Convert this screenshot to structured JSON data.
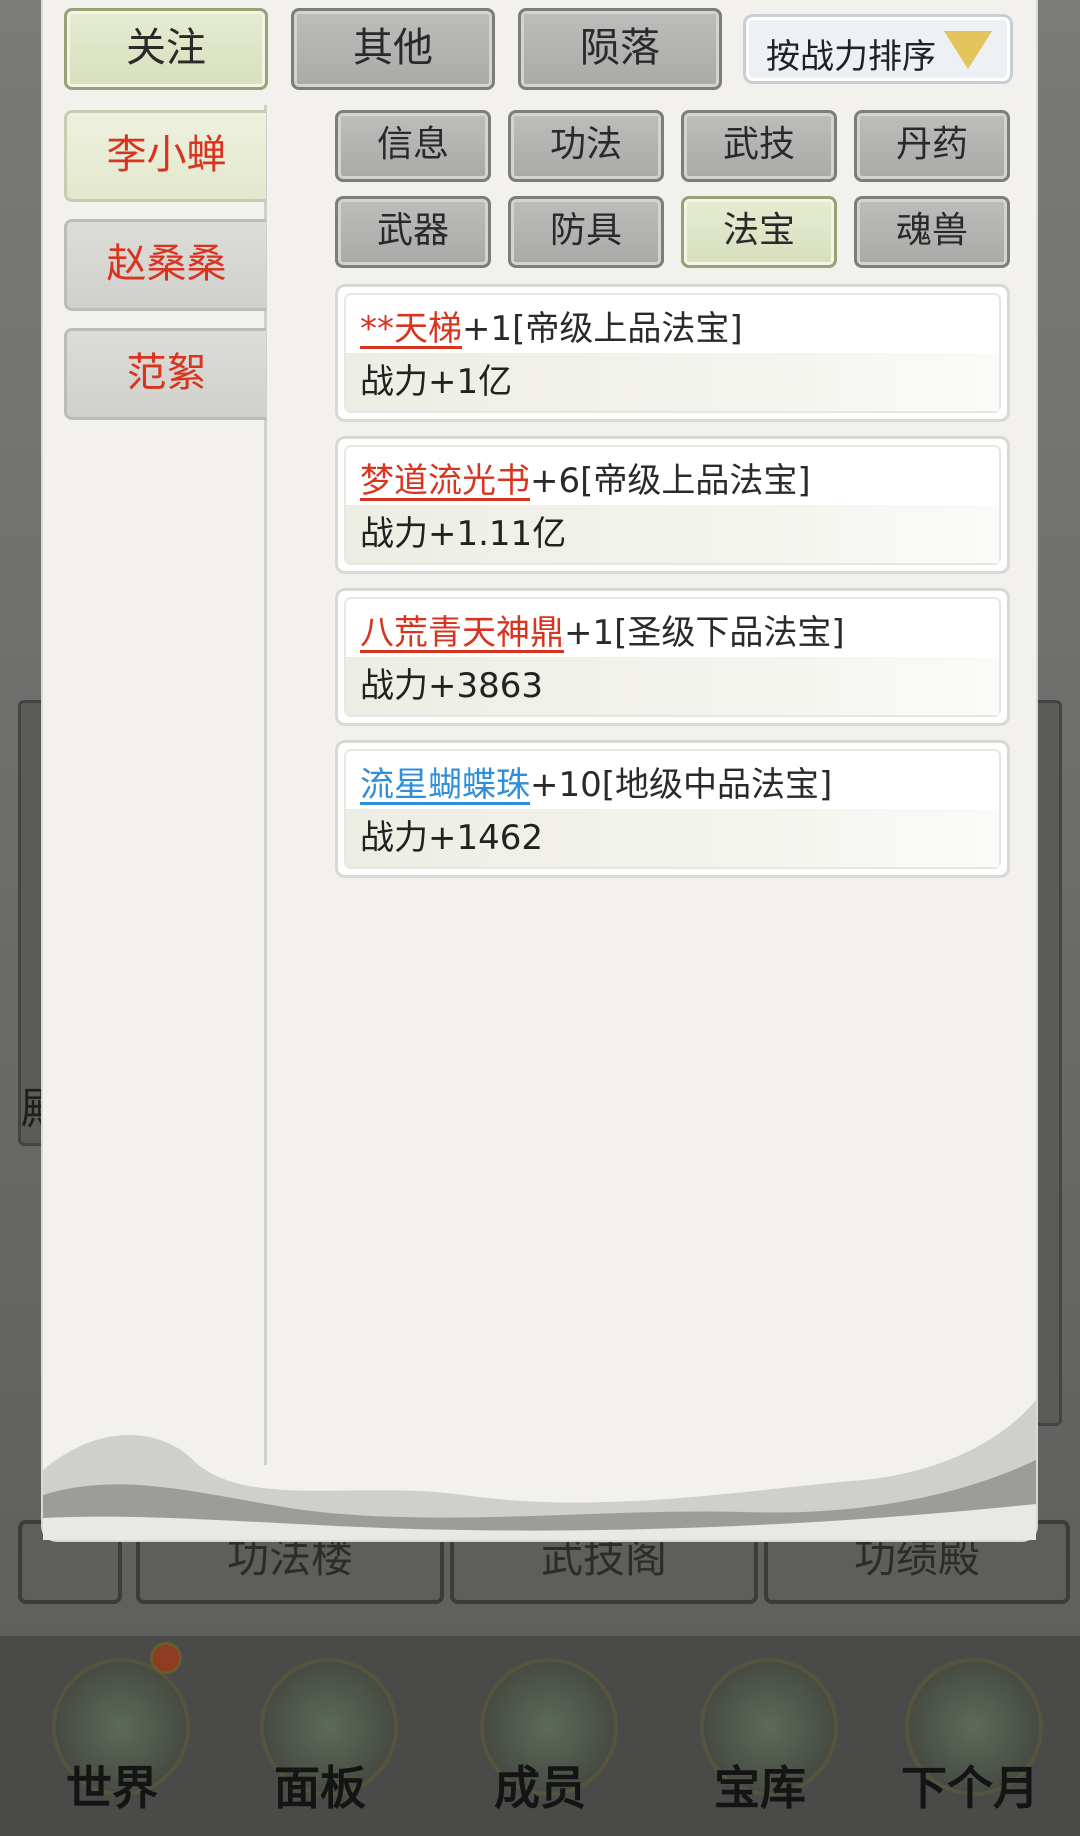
{
  "top_tabs": [
    {
      "label": "关注",
      "active": true
    },
    {
      "label": "其他",
      "active": false
    },
    {
      "label": "陨落",
      "active": false
    }
  ],
  "sort": {
    "label": "按战力排序"
  },
  "members": [
    {
      "name": "李小蝉",
      "active": true
    },
    {
      "name": "赵桑桑",
      "active": false
    },
    {
      "name": "范絮",
      "active": false
    }
  ],
  "categories": [
    {
      "label": "信息",
      "active": false
    },
    {
      "label": "功法",
      "active": false
    },
    {
      "label": "武技",
      "active": false
    },
    {
      "label": "丹药",
      "active": false
    },
    {
      "label": "武器",
      "active": false
    },
    {
      "label": "防具",
      "active": false
    },
    {
      "label": "法宝",
      "active": true
    },
    {
      "label": "魂兽",
      "active": false
    }
  ],
  "items": [
    {
      "name": "**天梯",
      "name_color": "#d8341f",
      "suffix": "+1[帝级上品法宝]",
      "power": "战力+1亿"
    },
    {
      "name": "梦道流光书",
      "name_color": "#d8341f",
      "suffix": "+6[帝级上品法宝]",
      "power": "战力+1.11亿"
    },
    {
      "name": "八荒青天神鼎",
      "name_color": "#d8341f",
      "suffix": "+1[圣级下品法宝]",
      "power": "战力+3863"
    },
    {
      "name": "流星蝴蝶珠",
      "name_color": "#2f8fd8",
      "suffix": "+10[地级中品法宝]",
      "power": "战力+1462"
    }
  ],
  "background": {
    "halls": [
      "功法楼",
      "武技阁",
      "功绩殿"
    ],
    "left_fragment": "殿",
    "nav": [
      {
        "label": "世界",
        "icon": "world-icon",
        "badge": true
      },
      {
        "label": "面板",
        "icon": "panel-icon",
        "badge": false
      },
      {
        "label": "成员",
        "icon": "member-icon",
        "badge": false
      },
      {
        "label": "宝库",
        "icon": "treasury-icon",
        "badge": false
      },
      {
        "label": "下个月",
        "icon": "next-month-icon",
        "badge": false
      }
    ]
  }
}
